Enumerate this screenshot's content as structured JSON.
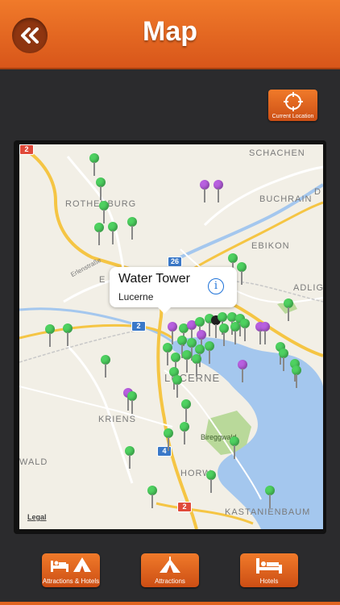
{
  "header": {
    "title": "Map",
    "back_icon": "double-chevron-left-icon"
  },
  "current_location": {
    "label": "Current Location",
    "icon": "crosshair-icon"
  },
  "map": {
    "places": [
      "SCHACHEN",
      "ROTHENBURG",
      "BUCHRAIN",
      "EBIKON",
      "Erlenstraße",
      "ADLIG",
      "KRIENS",
      "Bireggwald",
      "WALD",
      "HORW",
      "KASTANIENBAUM",
      "LUCERNE",
      "E",
      "D"
    ],
    "shields": [
      "2",
      "26",
      "2",
      "4",
      "2"
    ],
    "legal": "Legal",
    "callout": {
      "title": "Water Tower",
      "subtitle": "Lucerne",
      "info_icon": "info-icon"
    }
  },
  "tabs": [
    {
      "label": "Attractions & Hotels",
      "icon": "bed-and-tent-icon"
    },
    {
      "label": "Attractions",
      "icon": "tent-icon"
    },
    {
      "label": "Hotels",
      "icon": "bed-icon"
    }
  ],
  "colors": {
    "accent": "#e8661f",
    "background": "#2b2b2d",
    "pin_green": "#4ed160",
    "pin_purple": "#b85fe0",
    "water": "#a4c7ee"
  }
}
